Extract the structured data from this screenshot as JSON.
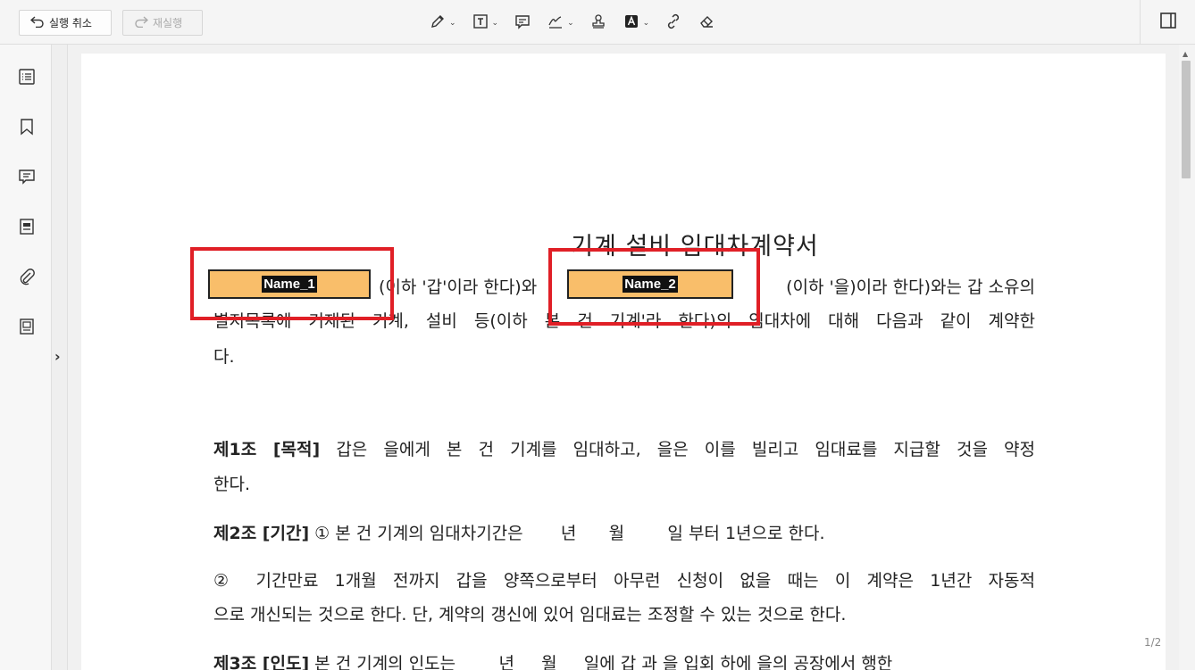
{
  "toolbar": {
    "undo_label": "실행 취소",
    "redo_label": "재실행",
    "tools": [
      {
        "name": "draw-tool-icon",
        "has_dropdown": true
      },
      {
        "name": "text-box-tool-icon",
        "has_dropdown": true
      },
      {
        "name": "comment-tool-icon",
        "has_dropdown": false
      },
      {
        "name": "signature-tool-icon",
        "has_dropdown": true
      },
      {
        "name": "stamp-tool-icon",
        "has_dropdown": false
      },
      {
        "name": "text-highlight-tool-icon",
        "has_dropdown": true
      },
      {
        "name": "link-tool-icon",
        "has_dropdown": false
      },
      {
        "name": "eraser-tool-icon",
        "has_dropdown": false
      }
    ]
  },
  "sidebar": {
    "items": [
      "outline-icon",
      "bookmark-icon",
      "comments-icon",
      "form-icon",
      "attachment-icon",
      "pages-icon"
    ]
  },
  "document": {
    "title": "기계 설비 임대차계약서",
    "fields": [
      {
        "label": "Name_1"
      },
      {
        "label": "Name_2"
      }
    ],
    "intro_line1_mid": "(이하 '갑'이라 한다)와",
    "intro_line1_end": "(이하 '을)이라 한다)와는 갑 소유의",
    "intro_line2": "별지목록에 기재된 기계, 설비 등(이하 본 건 기계'라 한다)의 임대차에 대해 다음과 같이 계약한",
    "intro_line3": "다.",
    "art1_head": "제1조 [목적]",
    "art1_text": "갑은 을에게 본 건 기계를 임대하고, 을은 이를 빌리고 임대료를 지급할 것을 약정",
    "art1_cont": "한다.",
    "art2_head": "제2조 [기간]",
    "art2_text": "① 본 건 기계의 임대차기간은       년      월        일 부터 1년으로 한다.",
    "art2_p2": "② 기간만료 1개월 전까지 갑을 양쪽으로부터 아무런 신청이 없을 때는 이 계약은 1년간 자동적",
    "art2_p2_cont": "으로 개신되는 것으로 한다. 단, 계약의 갱신에 있어 임대료는 조정할 수 있는 것으로 한다.",
    "art3_head": "제3조 [인도]",
    "art3_text": "본 건 기계의 인도는        년     월     일에 갑 과 을 입회 하에 을의 공장에서 행한"
  },
  "page_indicator": "1/2",
  "colors": {
    "field_fill": "#f9be6a",
    "highlight_border": "#e01f26"
  }
}
